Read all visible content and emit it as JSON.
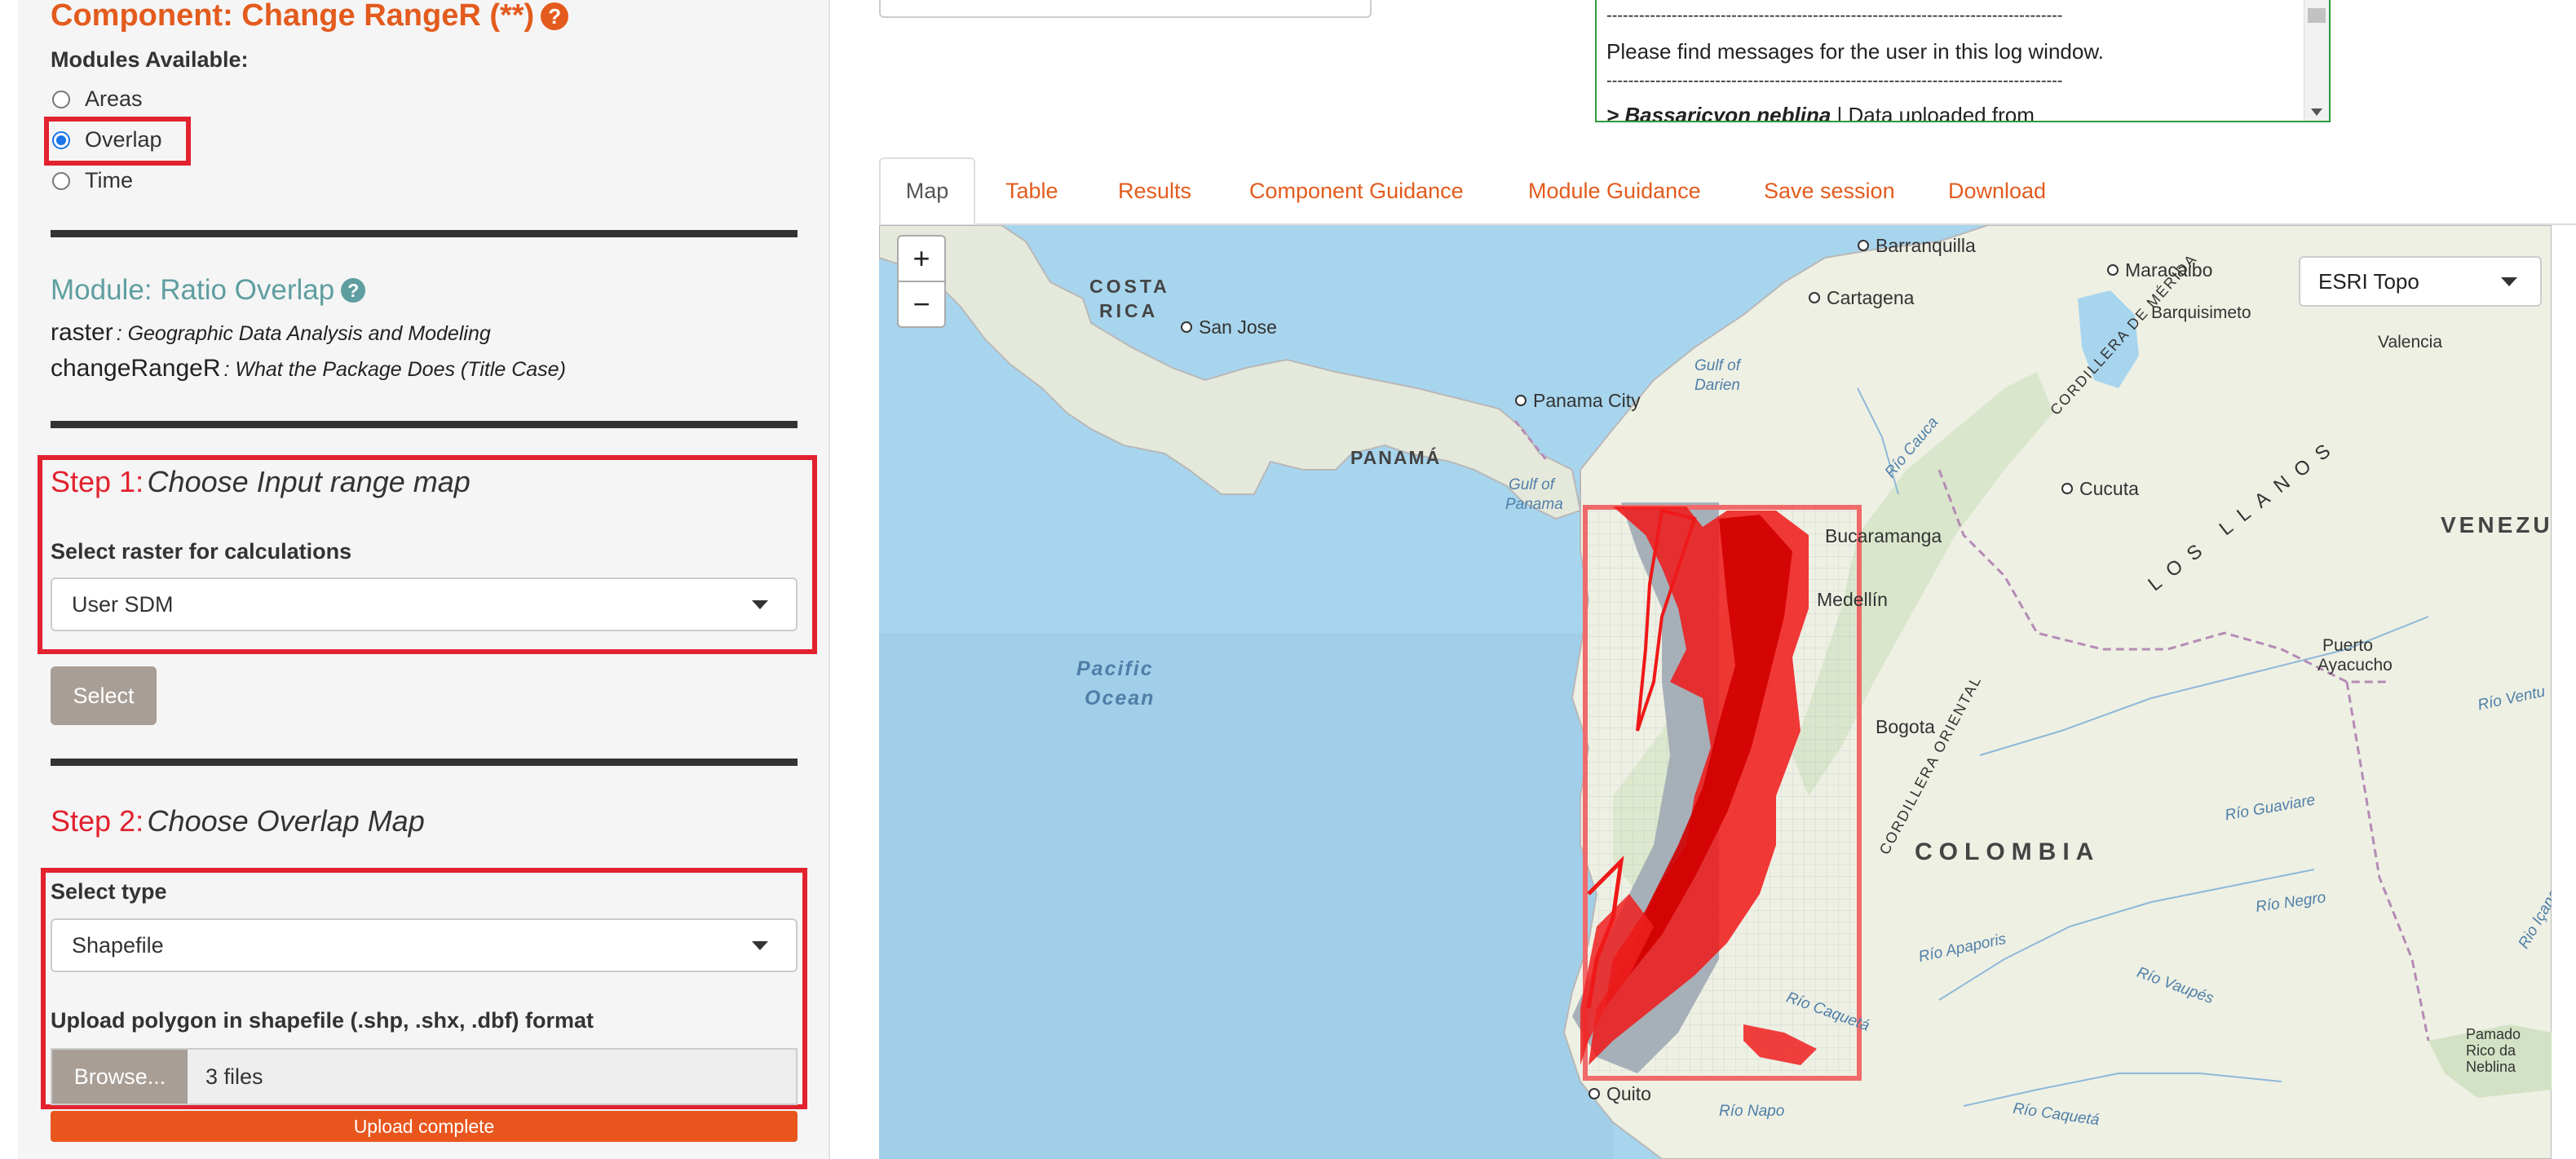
{
  "sidebar": {
    "component_title": "Component: Change RangeR (**)",
    "modules_label": "Modules Available:",
    "modules": [
      "Areas",
      "Overlap",
      "Time"
    ],
    "selected_module": "Overlap",
    "module_title": "Module: Ratio Overlap",
    "packages": [
      {
        "name": "raster",
        "desc": ": Geographic Data Analysis and Modeling"
      },
      {
        "name": "changeRangeR",
        "desc": ": What the Package Does (Title Case)"
      }
    ],
    "step1": {
      "label": "Step 1:",
      "title": "Choose Input range map",
      "select_label": "Select raster for calculations",
      "select_value": "User SDM",
      "button": "Select"
    },
    "step2": {
      "label": "Step 2:",
      "title": "Choose Overlap Map",
      "type_label": "Select type",
      "type_value": "Shapefile",
      "upload_label": "Upload polygon in shapefile (.shp, .shx, .dbf) format",
      "browse_button": "Browse...",
      "file_value": "3 files",
      "progress_text": "Upload complete",
      "progress_percent": 100
    }
  },
  "log": {
    "separator": "------------------------------------------------------------------------------------",
    "message": "Please find messages for the user in this log window.",
    "entry_species": "> Bassaricyon neblina",
    "entry_text": " | Data uploaded from"
  },
  "tabs": [
    "Map",
    "Table",
    "Results",
    "Component Guidance",
    "Module Guidance",
    "Save session",
    "Download"
  ],
  "active_tab": "Map",
  "map": {
    "basemap": "ESRI Topo",
    "zoom_in": "+",
    "zoom_out": "−",
    "labels": {
      "barranquilla": "Barranquilla",
      "maracaibo": "Maracaibo",
      "costa_rica_1": "COSTA",
      "costa_rica_2": "RICA",
      "cartagena": "Cartagena",
      "barquisimeto": "Barquisimeto",
      "valencia": "Valencia",
      "san_jose": "San Jose",
      "gulf_darien_1": "Gulf of",
      "gulf_darien_2": "Darien",
      "panama_city": "Panama City",
      "panama": "PANAMÁ",
      "rio_cauca": "Río Cauca",
      "cucuta": "Cucuta",
      "gulf_panama_1": "Gulf of",
      "gulf_panama_2": "Panama",
      "bucaramanga": "Bucaramanga",
      "cordillera_merida": "CORDILLERA DE MÉRIDA",
      "los_llanos": "LOS LLANOS",
      "venezuela": "VENEZU",
      "medellin": "Medellín",
      "pacific_1": "Pacific",
      "pacific_2": "Ocean",
      "puerto_ayacucho_1": "Puerto",
      "puerto_ayacucho_2": "Ayacucho",
      "bogota": "Bogota",
      "cordillera_oriental": "CORDILLERA ORIENTAL",
      "rio_ventu": "Río Ventu",
      "rio_guaviare": "Río Guaviare",
      "colombia": "COLOMBIA",
      "rio_negro": "Río Negro",
      "rio_apaporis": "Río Apaporis",
      "rio_vaupes": "Río Vaupés",
      "pamado_1": "Pamado",
      "pamado_2": "Rico da",
      "pamado_3": "Neblina",
      "quito": "Quito",
      "rio_napo": "Río Napo",
      "rio_caqueta": "Río Caquetá",
      "rio_icana": "Rio Içana"
    }
  }
}
